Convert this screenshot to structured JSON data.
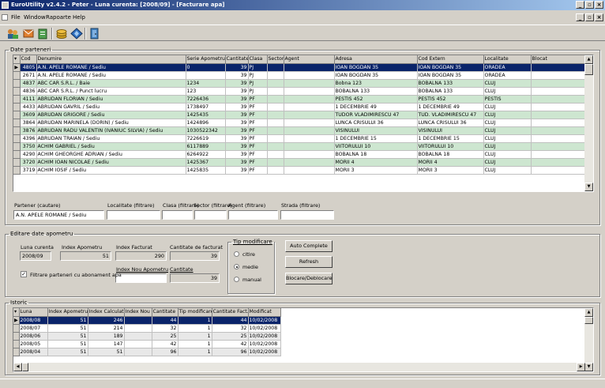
{
  "window": {
    "title": "EuroUtility v2.4.2 - Peter - Luna curenta: [2008/09] - [Facturare apa]"
  },
  "menu": [
    "File",
    "Window",
    "Rapoarte",
    "Help"
  ],
  "toolbar": {
    "icons": [
      "users-icon",
      "mail-icon",
      "report-icon",
      "coins-icon",
      "diamond-icon",
      "exit-door-icon"
    ]
  },
  "parteneri": {
    "legend": "Date parteneri",
    "columns": [
      "Cod",
      "Denumire",
      "Serie Apometru",
      "Cantitate",
      "Clasa",
      "Sector",
      "Agent",
      "Adresa",
      "Cod Extern",
      "Localitate",
      "Blocat"
    ],
    "rows": [
      [
        "4805",
        "A.N. APELE ROMANE / Sediu",
        "0",
        "39",
        "PJ",
        "",
        "",
        "IOAN BOGDAN 35",
        "IOAN BOGDAN 35",
        "ORADEA",
        ""
      ],
      [
        "2671",
        "A.N. APELE ROMANE / Sediu",
        "",
        "39",
        "PJ",
        "",
        "",
        "IOAN BOGDAN 35",
        "IOAN BOGDAN 35",
        "ORADEA",
        ""
      ],
      [
        "4837",
        "ABC CAR S.R.L. / Baie",
        "1234",
        "39",
        "PJ",
        "",
        "",
        "Bobna 123",
        "BOBALNA 133",
        "CLUJ",
        ""
      ],
      [
        "4836",
        "ABC CAR S.R.L. / Punct lucru",
        "123",
        "39",
        "PJ",
        "",
        "",
        "BOBALNA 133",
        "BOBALNA 133",
        "CLUJ",
        ""
      ],
      [
        "4111",
        "ABRUDAN FLORIAN / Sediu",
        "7226436",
        "39",
        "PF",
        "",
        "",
        "PESTIS 452",
        "PESTIS 452",
        "PESTIS",
        ""
      ],
      [
        "4433",
        "ABRUDAN GAVRIL / Sediu",
        "1738497",
        "39",
        "PF",
        "",
        "",
        "1 DECEMBRIE 49",
        "1 DECEMBRIE 49",
        "CLUJ",
        ""
      ],
      [
        "3609",
        "ABRUDAN GRIGORE / Sediu",
        "1425435",
        "39",
        "PF",
        "",
        "",
        "TUDOR VLADIMIRESCU 47",
        "TUD. VLADIMIRESCU 47",
        "CLUJ",
        ""
      ],
      [
        "3864",
        "ABRUDAN MARINELA (DORIN) / Sediu",
        "1424896",
        "39",
        "PF",
        "",
        "",
        "LUNCA CRISULUI 36",
        "LUNCA CRISULUI 36",
        "CLUJ",
        ""
      ],
      [
        "3876",
        "ABRUDAN RADU VALENTIN (IVANIUC SILVIA) / Sediu",
        "1030522342",
        "39",
        "PF",
        "",
        "",
        "VISINULUI",
        "VISINULUI",
        "CLUJ",
        ""
      ],
      [
        "4396",
        "ABRUDAN TRAIAN / Sediu",
        "7226619",
        "39",
        "PF",
        "",
        "",
        "1 DECEMBRIE 15",
        "1 DECEMBRIE 15",
        "CLUJ",
        ""
      ],
      [
        "3750",
        "ACHIM GABRIEL / Sediu",
        "6117889",
        "39",
        "PF",
        "",
        "",
        "VIITORULUI 10",
        "VIITORULUI 10",
        "CLUJ",
        ""
      ],
      [
        "4290",
        "ACHIM GHEORGHE ADRIAN / Sediu",
        "6264922",
        "39",
        "PF",
        "",
        "",
        "BOBALNA 18",
        "BOBALNA 18",
        "CLUJ",
        ""
      ],
      [
        "3720",
        "ACHIM IOAN NICOLAE / Sediu",
        "1425367",
        "39",
        "PF",
        "",
        "",
        "MORII 4",
        "MORII 4",
        "CLUJ",
        ""
      ],
      [
        "3719",
        "ACHIM IOSIF / Sediu",
        "1425835",
        "39",
        "PF",
        "",
        "",
        "MORII 3",
        "MORII 3",
        "CLUJ",
        ""
      ]
    ]
  },
  "filters": {
    "partener_label": "Partener (cautare)",
    "partener_value": "A.N. APELE ROMANE / Sediu",
    "localitate_label": "Localitate (filtrare)",
    "clasa_label": "Clasa (filtrare)",
    "sector_label": "Sector (filtrare)",
    "agent_label": "Agent (filtrare)",
    "strada_label": "Strada (filtrare)"
  },
  "editare": {
    "legend": "Editare date apometru",
    "luna_label": "Luna curenta",
    "luna_value": "2008/09",
    "index_apometru_label": "Index Apometru",
    "index_apometru_value": "51",
    "index_facturat_label": "Index Facturat",
    "index_facturat_value": "290",
    "cantitate_facturat_label": "Cantitate de facturat",
    "cantitate_facturat_value": "39",
    "index_nou_label": "Index Nou Apometru",
    "index_nou_value": "",
    "cantitate_label": "Cantitate",
    "cantitate_value": "39",
    "filtrare_label": "Filtrare parteneri cu abonament apa",
    "tip_label": "Tip modificare",
    "radio_citire": "citire",
    "radio_medie": "medie",
    "radio_manual": "manual",
    "btn_autocomplete": "Auto Complete",
    "btn_refresh": "Refresh",
    "btn_blocare": "Blocare/Deblocare"
  },
  "istoric": {
    "legend": "Istoric",
    "columns": [
      "Luna",
      "Index Apometru",
      "Index Calculat",
      "Index Nou",
      "Cantitate",
      "Tip modificare",
      "Cantitate Fact.",
      "Modificat"
    ],
    "rows": [
      [
        "2008/08",
        "51",
        "246",
        "",
        "44",
        "1",
        "44",
        "10/02/2008"
      ],
      [
        "2008/07",
        "51",
        "214",
        "",
        "32",
        "1",
        "32",
        "10/02/2008"
      ],
      [
        "2008/06",
        "51",
        "189",
        "",
        "25",
        "1",
        "25",
        "10/02/2008"
      ],
      [
        "2008/05",
        "51",
        "147",
        "",
        "42",
        "1",
        "42",
        "10/02/2008"
      ],
      [
        "2008/04",
        "51",
        "51",
        "",
        "96",
        "1",
        "96",
        "10/02/2008"
      ]
    ]
  },
  "colors": {
    "selected": "#0a246a",
    "row_alt": "#cde6d0",
    "title_start": "#0a246a",
    "title_end": "#a6caf0"
  }
}
